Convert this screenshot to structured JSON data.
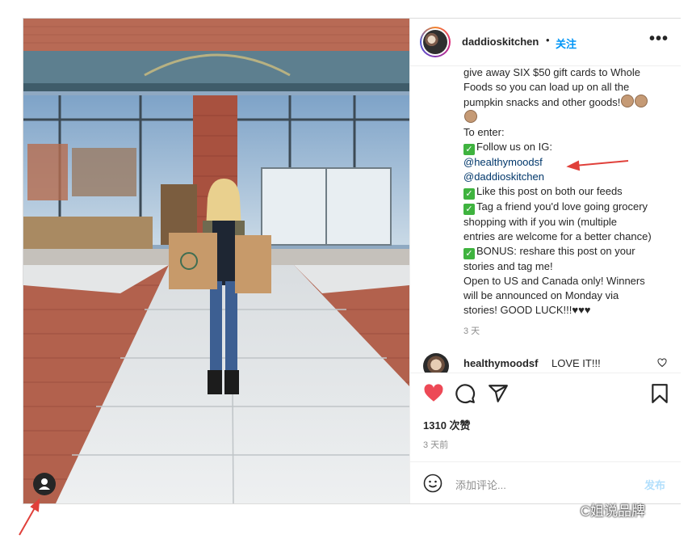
{
  "header": {
    "username": "daddioskitchen",
    "separator": "•",
    "follow_label": "关注",
    "more_label": "•••"
  },
  "caption": {
    "lines": [
      "give away SIX $50 gift cards to Whole",
      "Foods so you can load up on all the",
      "pumpkin snacks and other goods!",
      "",
      "To enter:",
      "Follow us on IG:",
      "@healthymoodsf",
      "@daddioskitchen",
      "Like this post on both our feeds",
      "Tag a friend you'd love going grocery",
      "shopping with if you win (multiple",
      "entries are welcome for a better chance)",
      "BONUS: reshare this post on your",
      "stories and tag me!",
      "Open to US and Canada only! Winners",
      "will be announced on Monday via",
      "stories! GOOD LUCK!!!♥♥♥"
    ],
    "time": "3 天"
  },
  "comment": {
    "username": "healthymoodsf",
    "text": "LOVE IT!!!"
  },
  "actions": {
    "likes": "1310 次赞",
    "time": "3 天前"
  },
  "comment_bar": {
    "placeholder": "添加评论...",
    "post_label": "发布"
  },
  "watermark": "C姐说品牌",
  "colors": {
    "heart": "#ed4956",
    "follow": "#0095f6",
    "link": "#00376b",
    "annotation_arrow": "#e0403a"
  }
}
